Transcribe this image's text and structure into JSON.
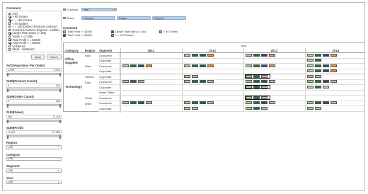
{
  "colors": {
    "light_green": "#a6d68e",
    "dark_green": "#1f6f3a",
    "dark_blue": "#1f4e79",
    "orange": "#f28e2b",
    "gray": "#bdbdbd",
    "pill_blue": "#b9cfe8"
  },
  "filters": {
    "title": "Comment",
    "items": [
      {
        "label": "(All)",
        "checked": false
      },
      {
        "label": "> 60 Orders",
        "checked": true
      },
      {
        "label": "> = 100 Orders",
        "checked": true
      },
      {
        "label": "< 60 Orders",
        "checked": false
      },
      {
        "label": "> = 100 Distinct Products Ordered",
        "checked": false
      },
      {
        "label": "Central & Eastern Regions - Unfiltered",
        "checked": false
      },
      {
        "label": "Larger Total Sales (> 25k)",
        "checked": true
      },
      {
        "label": "Sales > = 0.35k",
        "checked": false
      },
      {
        "label": "Total Profit > = $2500",
        "checked": true
      },
      {
        "label": "Total Profit < = $5000",
        "checked": true
      },
      {
        "label": "Unfiltered",
        "checked": false
      },
      {
        "label": "West - Unfiltered",
        "checked": false
      }
    ],
    "apply": "Apply",
    "cancel": "Cancel"
  },
  "sliders": [
    {
      "title": "AVG(Avg Items Per Order)",
      "min": "1.999",
      "max": "3.214"
    },
    {
      "title": "SUM(Product Count)",
      "min": "4",
      "max": "354"
    },
    {
      "title": "SUM(Order Count)",
      "min": "4",
      "max": "405"
    },
    {
      "title": "SUM(Sales)",
      "min": "466",
      "max": "71,115"
    },
    {
      "title": "SUM(Profit)",
      "min": "-4,000",
      "max": "27,658"
    }
  ],
  "dropdowns": [
    {
      "title": "Region",
      "value": "(All)"
    },
    {
      "title": "Category",
      "value": "(All)"
    },
    {
      "title": "Segment",
      "value": "(All)"
    },
    {
      "title": "Year",
      "value": "(All)"
    }
  ],
  "shelves": {
    "columns_label": "Columns",
    "columns": [
      "Year"
    ],
    "rows_label": "Rows",
    "rows": [
      "Category",
      "Region",
      "Segment"
    ]
  },
  "legend": {
    "title": "Comment",
    "items": [
      {
        "label": "Total Profit >= $2500",
        "color": "#a6d68e"
      },
      {
        "label": "Larger Total Sales (> 25k)",
        "color": "#1f4e79"
      },
      {
        "label": "< 60 Orders",
        "color": "#bdbdbd"
      },
      {
        "label": "Total Profit <= $5000",
        "color": "#1f6f3a"
      },
      {
        "label": "> = 100 Orders",
        "color": "#f28e2b"
      }
    ]
  },
  "table": {
    "headers": {
      "category": "Category",
      "region": "Region",
      "segment": "Segment",
      "year": "Year"
    },
    "years": [
      "2011",
      "2012",
      "2013",
      "2014"
    ],
    "categories": [
      {
        "name": "Office Supplies"
      },
      {
        "name": "Technology"
      }
    ],
    "rows": [
      {
        "category": "Office Supplies",
        "region": "East",
        "segment": "Consumer",
        "marks": [
          [],
          [
            "LG",
            "DG",
            "DB",
            "OR"
          ],
          [
            "LG",
            "DG",
            "DB",
            "OR"
          ],
          [
            "LG",
            "DG",
            "DB",
            "OR"
          ]
        ]
      },
      {
        "category": "",
        "region": "",
        "segment": "Corporate",
        "marks": [
          [],
          [],
          [],
          [
            "LG",
            "DG"
          ]
        ]
      },
      {
        "category": "",
        "region": "West",
        "segment": "Consumer",
        "marks": [
          [
            "LG",
            "DG",
            "DB",
            "OR"
          ],
          [
            "LG",
            "DG",
            "DB",
            "OR"
          ],
          [
            "LG",
            "DG",
            "DB",
            "OR"
          ],
          [
            "LG",
            "DG",
            "DB",
            "OR"
          ]
        ]
      },
      {
        "category": "",
        "region": "",
        "segment": "Corporate",
        "marks": [
          [],
          [],
          [],
          [
            "LG",
            "DG",
            "DB",
            "OR"
          ]
        ]
      },
      {
        "category": "Technology",
        "region": "Central",
        "segment": "Corporate",
        "marks": [
          [],
          [
            "LG",
            "GR"
          ],
          [
            "LG",
            "DG",
            "GR"
          ],
          [
            "LG",
            "GR"
          ]
        ]
      },
      {
        "category": "",
        "region": "East",
        "segment": "Consumer",
        "marks": [
          [
            "LG",
            "DG",
            "GR"
          ],
          [
            "LG",
            "DG",
            "DB",
            "GR"
          ],
          [
            "LG",
            "DG",
            "DB",
            "GR"
          ],
          [
            "LG",
            "DG",
            "DB",
            "GR"
          ]
        ]
      },
      {
        "category": "",
        "region": "",
        "segment": "Corporate",
        "marks": [
          [],
          [],
          [
            "LG",
            "DG",
            "GR"
          ],
          [
            "LG",
            "DG",
            "GR"
          ]
        ]
      },
      {
        "category": "",
        "region": "",
        "segment": "Home Office",
        "marks": [
          [],
          [],
          [],
          []
        ]
      },
      {
        "category": "",
        "region": "South",
        "segment": "Consumer",
        "marks": [
          [],
          [],
          [
            "LG",
            "DG",
            "GR"
          ],
          []
        ]
      },
      {
        "category": "",
        "region": "West",
        "segment": "Consumer",
        "marks": [
          [
            "LG",
            "DG",
            "DB",
            "GR"
          ],
          [
            "LG",
            "DG",
            "DB",
            "GR"
          ],
          [
            "LG",
            "DG",
            "DB",
            "GR"
          ],
          [
            "LG",
            "DG",
            "DB",
            "GR"
          ]
        ]
      },
      {
        "category": "",
        "region": "",
        "segment": "Corporate",
        "marks": [
          [],
          [
            "LG",
            "GR"
          ],
          [
            "LG",
            "DG",
            "GR"
          ],
          [
            "LG",
            "GR"
          ]
        ]
      }
    ],
    "selected_cells": [
      [
        4,
        2
      ],
      [
        6,
        2
      ],
      [
        8,
        2
      ]
    ]
  }
}
